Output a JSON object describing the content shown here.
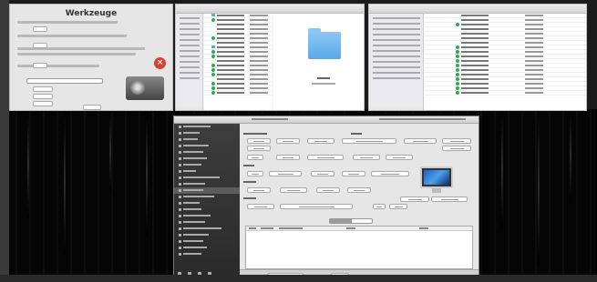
{
  "tools_panel": {
    "title": "Werkzeuge",
    "close_icon": "close-icon",
    "drive_icon": "hard-drive-icon"
  },
  "finder_left": {
    "folder_icon": "folder-icon"
  },
  "finder_right": {},
  "app_window": {
    "sidebar_icons": [
      "item-icon"
    ],
    "footer_icons": [
      "add-icon",
      "remove-icon",
      "settings-icon",
      "info-icon"
    ],
    "display_icon": "imac-icon"
  },
  "colors": {
    "close_red": "#d8412f",
    "folder_blue": "#5ba9ea",
    "status_green": "#34a853",
    "sidebar_dark": "#2a2a2a"
  }
}
